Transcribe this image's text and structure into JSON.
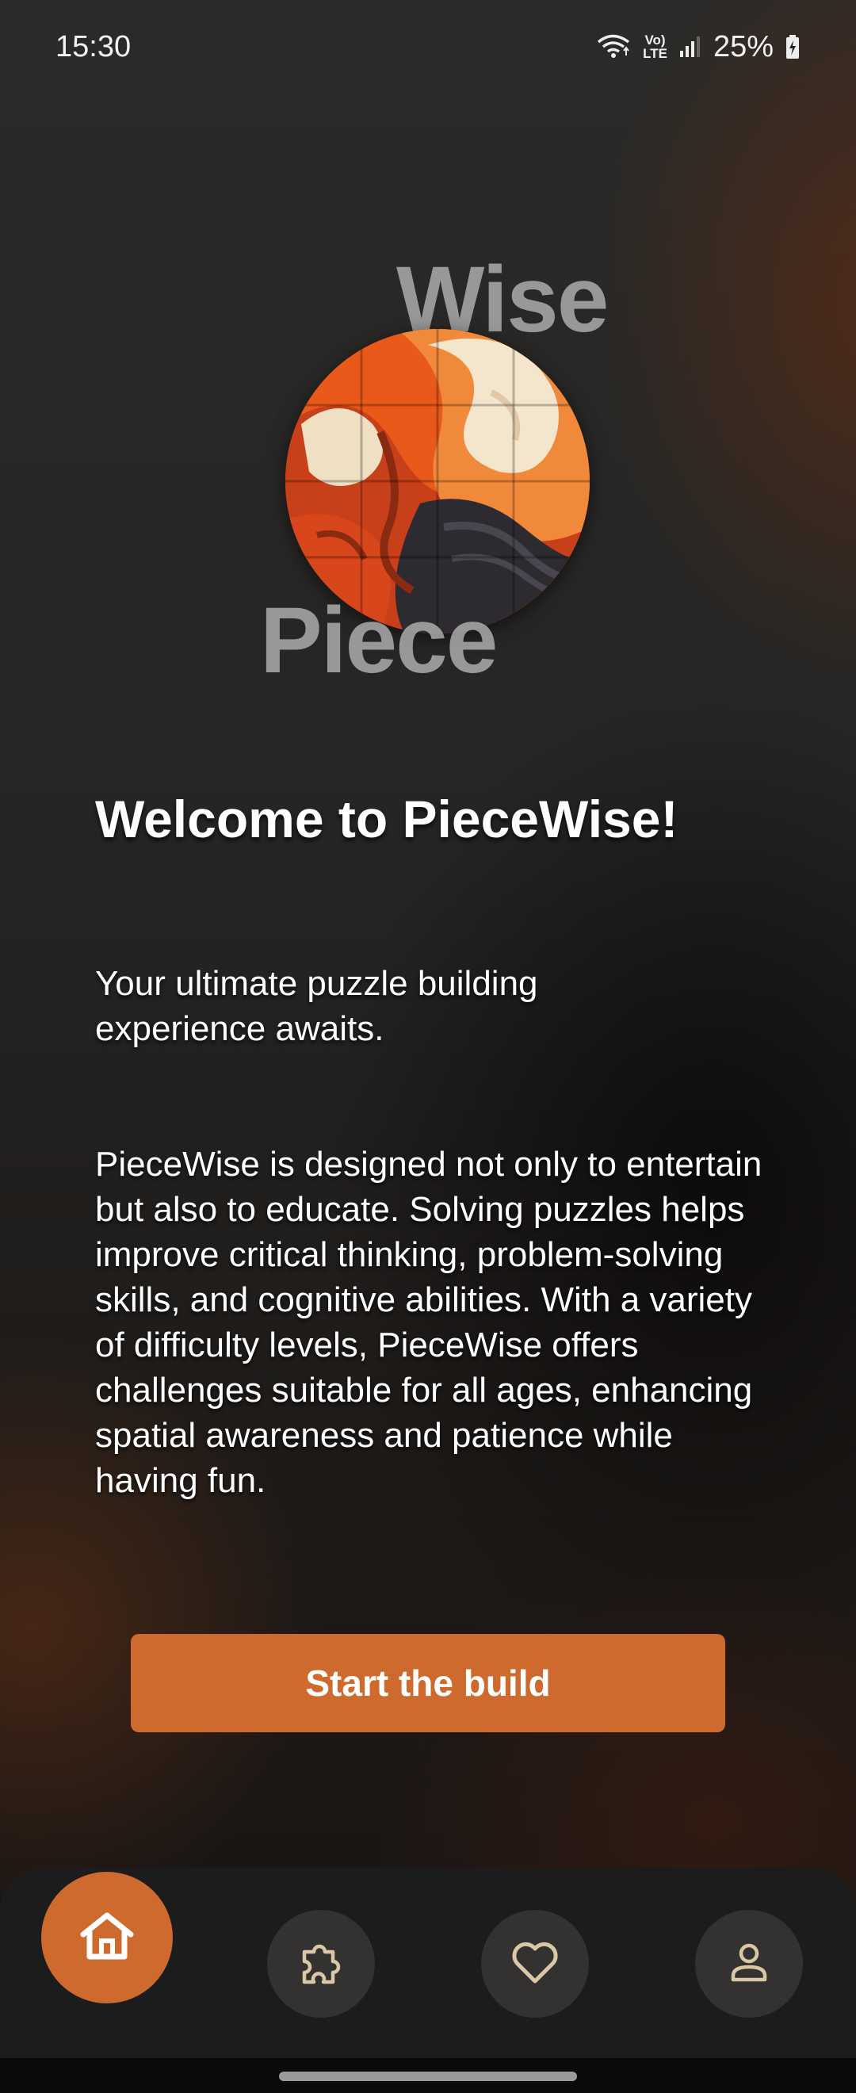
{
  "status_bar": {
    "time": "15:30",
    "lte_top": "Vo)",
    "lte_bottom": "LTE",
    "battery": "25%",
    "icons": [
      "wifi-icon",
      "volte-icon",
      "signal-icon",
      "battery-charging-icon"
    ]
  },
  "logo": {
    "word_top": "Wise",
    "word_bottom": "Piece"
  },
  "main": {
    "title": "Welcome to PieceWise!",
    "tagline": "Your ultimate puzzle building experience awaits.",
    "description": "PieceWise is designed not only to entertain but also to educate. Solving puzzles helps improve critical thinking, problem-solving skills, and cognitive abilities. With a variety of difficulty levels, PieceWise offers challenges suitable for all ages, enhancing spatial awareness and patience while having fun.",
    "start_button_label": "Start the build"
  },
  "bottom_nav": {
    "items": [
      {
        "icon": "home-icon",
        "active": true
      },
      {
        "icon": "puzzle-icon",
        "active": false
      },
      {
        "icon": "heart-icon",
        "active": false
      },
      {
        "icon": "person-icon",
        "active": false
      }
    ]
  },
  "colors": {
    "accent": "#cf6a2e",
    "background": "#262523",
    "nav_background": "#1c1c1c",
    "nav_inactive": "#333231",
    "nav_icon_inactive": "#d9c7a6"
  }
}
